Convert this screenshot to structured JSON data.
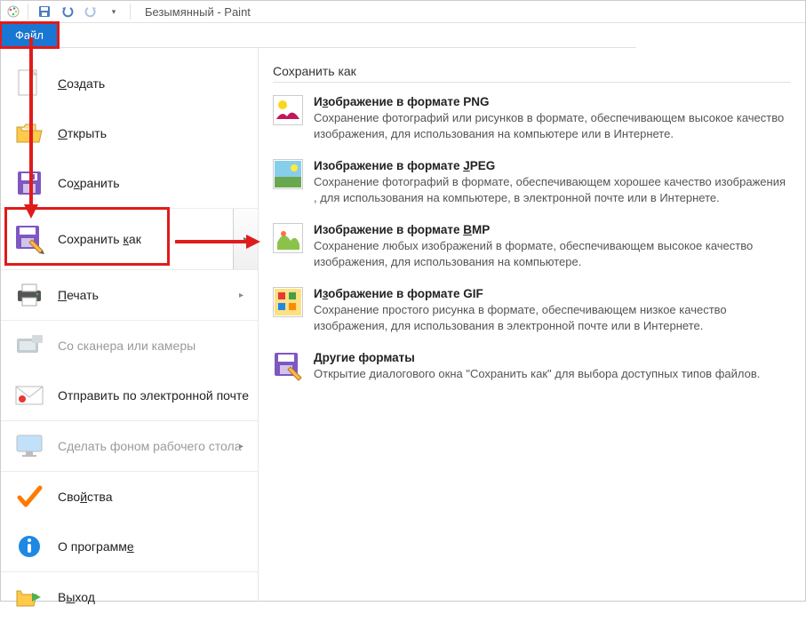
{
  "titlebar": {
    "title": "Безымянный - Paint"
  },
  "ribbon": {
    "file_tab": "Файл"
  },
  "menu": {
    "create": "Создать",
    "open": "Открыть",
    "save": "Сохранить",
    "save_as": "Сохранить как",
    "print": "Печать",
    "scanner": "Со сканера или камеры",
    "email": "Отправить по электронной почте",
    "wallpaper": "Сделать фоном рабочего стола",
    "properties": "Свойства",
    "about": "О программе",
    "exit": "Выход"
  },
  "panel": {
    "title": "Сохранить как",
    "formats": [
      {
        "title_pre": "И",
        "title_u": "з",
        "title_post": "ображение в формате PNG",
        "desc": "Сохранение фотографий или рисунков в формате, обеспечивающем высокое качество изображения, для использования на компьютере или в Интернете."
      },
      {
        "title_pre": "Изображение в формате ",
        "title_u": "J",
        "title_post": "PEG",
        "desc": "Сохранение фотографий в формате, обеспечивающем хорошее качество изображения , для использования на компьютере, в электронной почте или в Интернете."
      },
      {
        "title_pre": "Изображение в формате ",
        "title_u": "B",
        "title_post": "MP",
        "desc": "Сохранение любых изображений в формате, обеспечивающем высокое качество изображения, для использования на компьютере."
      },
      {
        "title_pre": "И",
        "title_u": "з",
        "title_post": "ображение в формате GIF",
        "desc": "Сохранение простого рисунка в формате, обеспечивающем низкое качество изображения, для использования в электронной почте или в Интернете."
      },
      {
        "title_pre": "",
        "title_u": "Д",
        "title_post": "ругие форматы",
        "desc": "Открытие диалогового окна \"Сохранить как\" для выбора доступных типов файлов."
      }
    ]
  }
}
